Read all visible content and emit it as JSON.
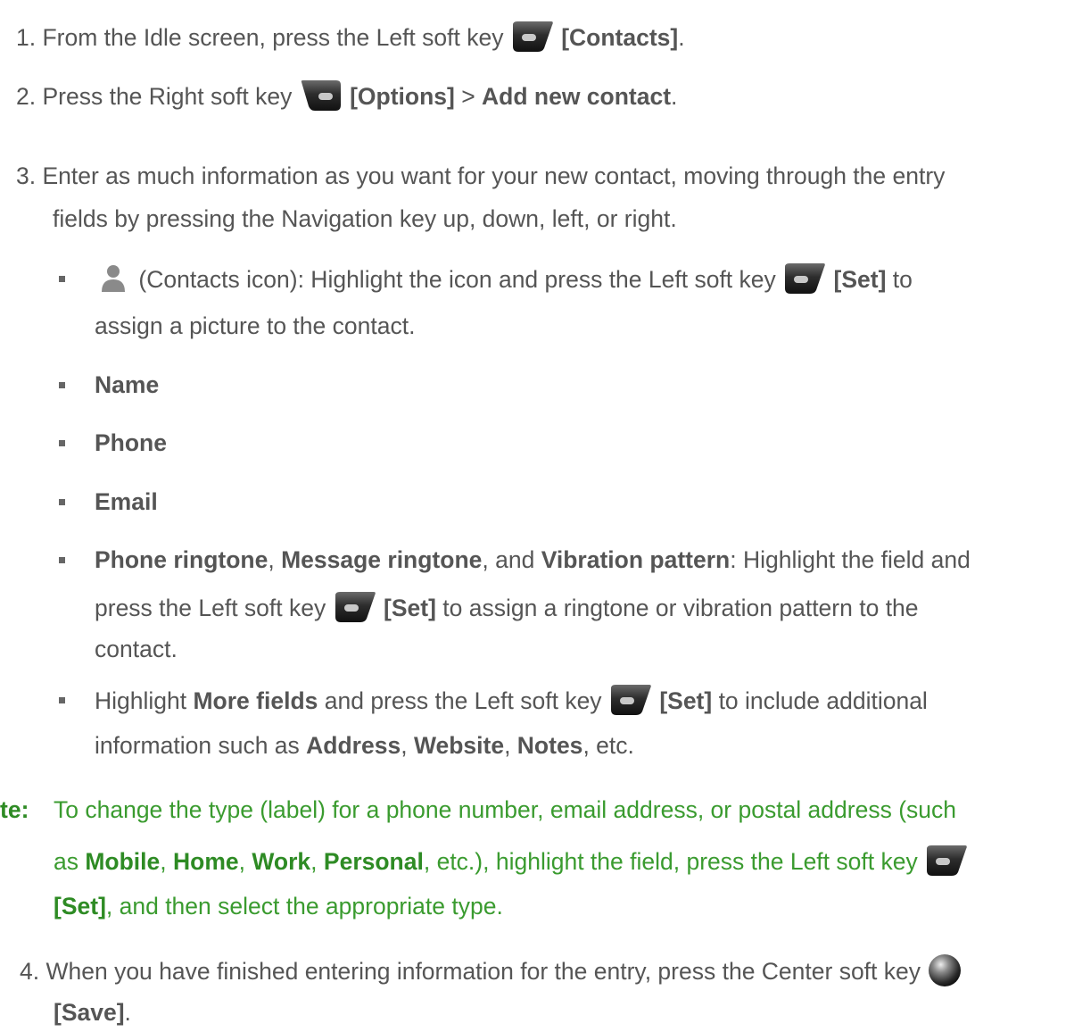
{
  "steps": [
    {
      "num": "1.",
      "pre": "From the Idle screen, press the Left soft key",
      "key_label": "[Contacts]",
      "post": "."
    },
    {
      "num": "2.",
      "pre": "Press the Right soft key",
      "key_label": "[Options]",
      "sep": " > ",
      "action": "Add new contact",
      "post": "."
    },
    {
      "num": "3.",
      "line1": "Enter as much information as you want for your new contact, moving through the entry",
      "line2": "fields by pressing the Navigation key up, down, left, or right."
    },
    {
      "num": "4.",
      "line1": "When you have finished entering information for the entry, press the Center soft key",
      "key_label": "[Save]",
      "post": "."
    }
  ],
  "bullets": {
    "contacts_icon": {
      "pre": "(Contacts icon): Highlight the icon and press the Left soft key",
      "key_label": "[Set]",
      "post": " to",
      "line2": "assign a picture to the contact."
    },
    "name": "Name",
    "phone": "Phone",
    "email": "Email",
    "ringtones": {
      "a": "Phone ringtone",
      "s1": ", ",
      "b": "Message ringtone",
      "s2": ", and ",
      "c": "Vibration pattern",
      "s3": ": Highlight the field and",
      "line2_pre": "press the Left soft key",
      "key_label": "[Set]",
      "line2_post": " to assign a ringtone or vibration pattern to the",
      "line3": "contact."
    },
    "more": {
      "pre": "Highlight ",
      "field": "More fields",
      "mid": " and press the Left soft key",
      "key_label": "[Set]",
      "post": " to include additional",
      "line2_pre": "information such as ",
      "f1": "Address",
      "s1": ", ",
      "f2": "Website",
      "s2": ", ",
      "f3": "Notes",
      "line2_post": ", etc."
    }
  },
  "note": {
    "label": "te:",
    "line1": "To change the type (label) for a phone number, email address, or postal address (such",
    "line2_pre": "as ",
    "t1": "Mobile",
    "s1": ", ",
    "t2": "Home",
    "s2": ", ",
    "t3": "Work",
    "s3": ", ",
    "t4": "Personal",
    "line2_post": ", etc.), highlight the field, press the Left soft key",
    "key_label": "[Set]",
    "line3_post": ", and then select the appropriate type."
  },
  "icons": [
    "left-soft-key-icon",
    "right-soft-key-icon",
    "contacts-person-icon",
    "center-soft-key-icon"
  ],
  "colors": {
    "body_text": "#555555",
    "note_text": "#3a9b2f",
    "note_bold": "#2e8b24"
  }
}
